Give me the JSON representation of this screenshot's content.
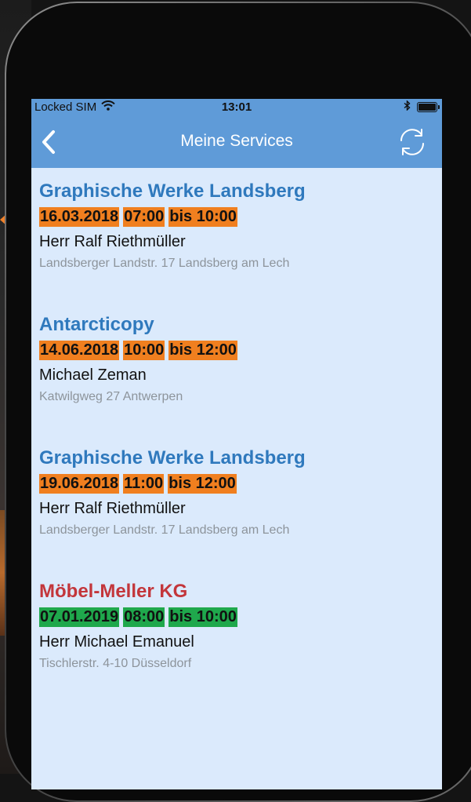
{
  "status_bar": {
    "carrier": "Locked SIM",
    "time": "13:01",
    "icons": [
      "wifi-icon",
      "bluetooth-icon",
      "battery-icon"
    ]
  },
  "nav": {
    "title": "Meine Services",
    "back_icon": "chevron-left-icon",
    "refresh_icon": "refresh-icon"
  },
  "colors": {
    "header": "#5f9bd8",
    "background": "#dbeafc",
    "company_blue": "#2f79bd",
    "company_red": "#c3363b",
    "chip_orange": "#f07f1f",
    "chip_green": "#1fa84c",
    "address_gray": "#8d949b"
  },
  "services": [
    {
      "company": "Graphische Werke Landsberg",
      "company_color": "#2f79bd",
      "date": "16.03.2018",
      "start": "07:00",
      "end": "bis 10:00",
      "chip_color": "#f07f1f",
      "contact": "Herr Ralf Riethmüller",
      "address": "Landsberger Landstr. 17 Landsberg am Lech"
    },
    {
      "company": "Antarcticopy",
      "company_color": "#2f79bd",
      "date": "14.06.2018",
      "start": "10:00",
      "end": "bis 12:00",
      "chip_color": "#f07f1f",
      "contact": "Michael Zeman",
      "address": "Katwilgweg 27 Antwerpen"
    },
    {
      "company": "Graphische Werke Landsberg",
      "company_color": "#2f79bd",
      "date": "19.06.2018",
      "start": "11:00",
      "end": "bis 12:00",
      "chip_color": "#f07f1f",
      "contact": "Herr Ralf Riethmüller",
      "address": "Landsberger Landstr. 17 Landsberg am Lech"
    },
    {
      "company": "Möbel-Meller KG",
      "company_color": "#c3363b",
      "date": "07.01.2019",
      "start": "08:00",
      "end": "bis 10:00",
      "chip_color": "#1fa84c",
      "contact": "Herr Michael Emanuel",
      "address": "Tischlerstr. 4-10 Düsseldorf"
    }
  ]
}
